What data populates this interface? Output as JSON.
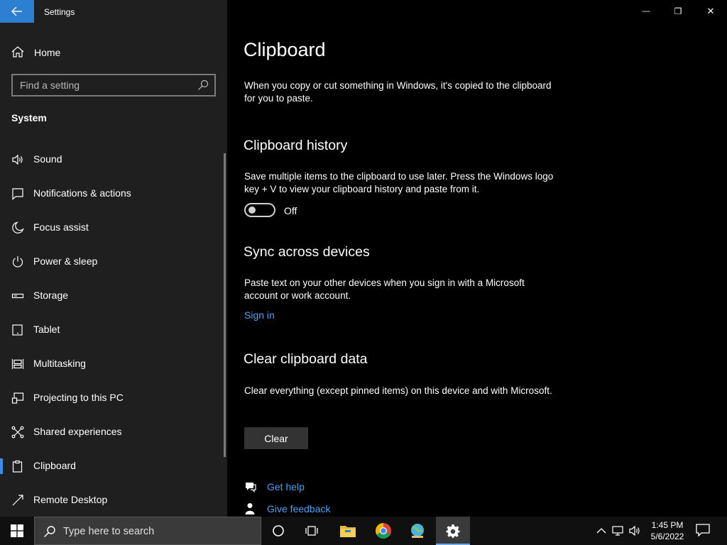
{
  "window": {
    "title": "Settings",
    "minimize_glyph": "—",
    "restore_glyph": "❐",
    "close_glyph": "✕"
  },
  "sidebar": {
    "home_label": "Home",
    "search_placeholder": "Find a setting",
    "section_title": "System",
    "items": [
      {
        "label": "Sound",
        "icon": "speaker-icon"
      },
      {
        "label": "Notifications & actions",
        "icon": "notification-icon"
      },
      {
        "label": "Focus assist",
        "icon": "moon-icon"
      },
      {
        "label": "Power & sleep",
        "icon": "power-icon"
      },
      {
        "label": "Storage",
        "icon": "storage-icon"
      },
      {
        "label": "Tablet",
        "icon": "tablet-icon"
      },
      {
        "label": "Multitasking",
        "icon": "multitasking-icon"
      },
      {
        "label": "Projecting to this PC",
        "icon": "projecting-icon"
      },
      {
        "label": "Shared experiences",
        "icon": "shared-icon"
      },
      {
        "label": "Clipboard",
        "icon": "clipboard-icon",
        "active": true
      },
      {
        "label": "Remote Desktop",
        "icon": "remote-desktop-icon"
      }
    ]
  },
  "main": {
    "title": "Clipboard",
    "intro": "When you copy or cut something in Windows, it's copied to the clipboard for you to paste.",
    "history": {
      "heading": "Clipboard history",
      "desc": "Save multiple items to the clipboard to use later. Press the Windows logo key + V to view your clipboard history and paste from it.",
      "toggle_state": "Off"
    },
    "sync": {
      "heading": "Sync across devices",
      "desc": "Paste text on your other devices when you sign in with a Microsoft account or work account.",
      "link": "Sign in"
    },
    "clear": {
      "heading": "Clear clipboard data",
      "desc": "Clear everything (except pinned items) on this device and with Microsoft.",
      "button": "Clear"
    },
    "help_link": "Get help",
    "feedback_link": "Give feedback"
  },
  "taskbar": {
    "search_text": "Type here to search",
    "time": "1:45 PM",
    "date": "5/6/2022"
  },
  "colors": {
    "accent": "#2d7fd2",
    "link": "#4ea1f0",
    "sidebar_bg": "#1f1f1f",
    "main_bg": "#000000"
  }
}
